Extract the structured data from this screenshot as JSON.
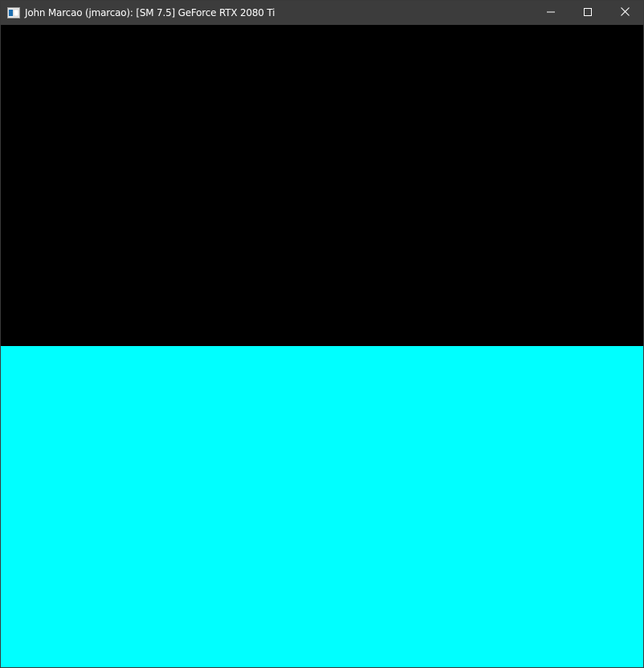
{
  "window": {
    "title": "John Marcao (jmarcao): [SM 7.5] GeForce RTX 2080 Ti",
    "icon": "application-window-icon",
    "controls": {
      "minimize_icon": "minimize-icon",
      "maximize_icon": "maximize-icon",
      "close_icon": "close-icon"
    }
  },
  "colors": {
    "titlebar": "#3c3c3c",
    "title_text": "#ffffff",
    "top_region": "#000000",
    "bottom_region": "#00ffff"
  },
  "canvas": {
    "regions": [
      {
        "name": "top",
        "color": "#000000"
      },
      {
        "name": "bottom",
        "color": "#00ffff"
      }
    ]
  }
}
